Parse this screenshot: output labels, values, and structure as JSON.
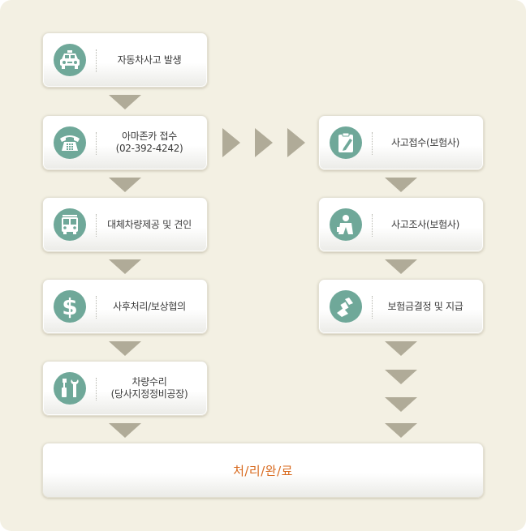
{
  "left_steps": [
    {
      "lines": [
        "자동차사고 발생"
      ],
      "icon": "taxi-icon"
    },
    {
      "lines": [
        "아마존카 접수",
        "(02-392-4242)"
      ],
      "icon": "telephone-icon"
    },
    {
      "lines": [
        "대체차량제공 및 견인"
      ],
      "icon": "bus-icon"
    },
    {
      "lines": [
        "사후처리/보상협의"
      ],
      "icon": "dollar-icon"
    },
    {
      "lines": [
        "차량수리",
        "(당사지정정비공장)"
      ],
      "icon": "tools-icon"
    }
  ],
  "right_steps": [
    {
      "lines": [
        "사고접수(보험사)"
      ],
      "icon": "clipboard-icon"
    },
    {
      "lines": [
        "사고조사(보험사)"
      ],
      "icon": "investigator-icon"
    },
    {
      "lines": [
        "보험금결정 및 지급"
      ],
      "icon": "stamp-icon"
    }
  ],
  "final": {
    "label": "처/리/완/료"
  },
  "colors": {
    "icon_bg": "#6fa899",
    "arrow": "#b0ab98",
    "final_text": "#d86a1e",
    "background": "#f3f0e3"
  }
}
